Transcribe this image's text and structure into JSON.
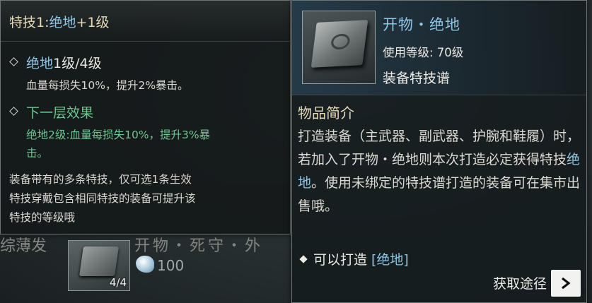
{
  "skill_tooltip": {
    "title_prefix": "特技1:",
    "title_skill": "绝地",
    "title_suffix": "+1级",
    "current": {
      "name": "绝地",
      "level": "1级/4级",
      "desc": "血量每损失10%，提升2%暴击。"
    },
    "next": {
      "header": "下一层效果",
      "desc_line1": "绝地2级:血量每损失10%，提升3%暴",
      "desc_line2": "击。"
    },
    "note_line1": "装备带有的多条特技，仅可选1条生效",
    "note_line2": "特技穿戴包含相同特技的装备可提升该",
    "note_line3": "特技的等级哦"
  },
  "item_tooltip": {
    "name": "开物・绝地",
    "use_level": "使用等级: 70级",
    "type": "装备特技谱",
    "section_title": "物品简介",
    "intro_part1": "打造装备（主武器、副武器、护腕和鞋履）时，若加入了开物・绝地则本次打造必定获得特技",
    "intro_highlight": "绝地",
    "intro_part2": "。使用未绑定的特技谱打造的装备可在集市出售哦。",
    "craft_label": "可以打造",
    "craft_tag": "[绝地]",
    "obtain_label": "获取途径"
  },
  "background_list": {
    "item_name": "开物・死守・外",
    "count": "4/4",
    "price": "100",
    "side_text": "综薄发"
  },
  "colors": {
    "skill_blue": "#8fc7e6",
    "next_green": "#6fc58f",
    "title_gold": "#e6d9b8"
  }
}
